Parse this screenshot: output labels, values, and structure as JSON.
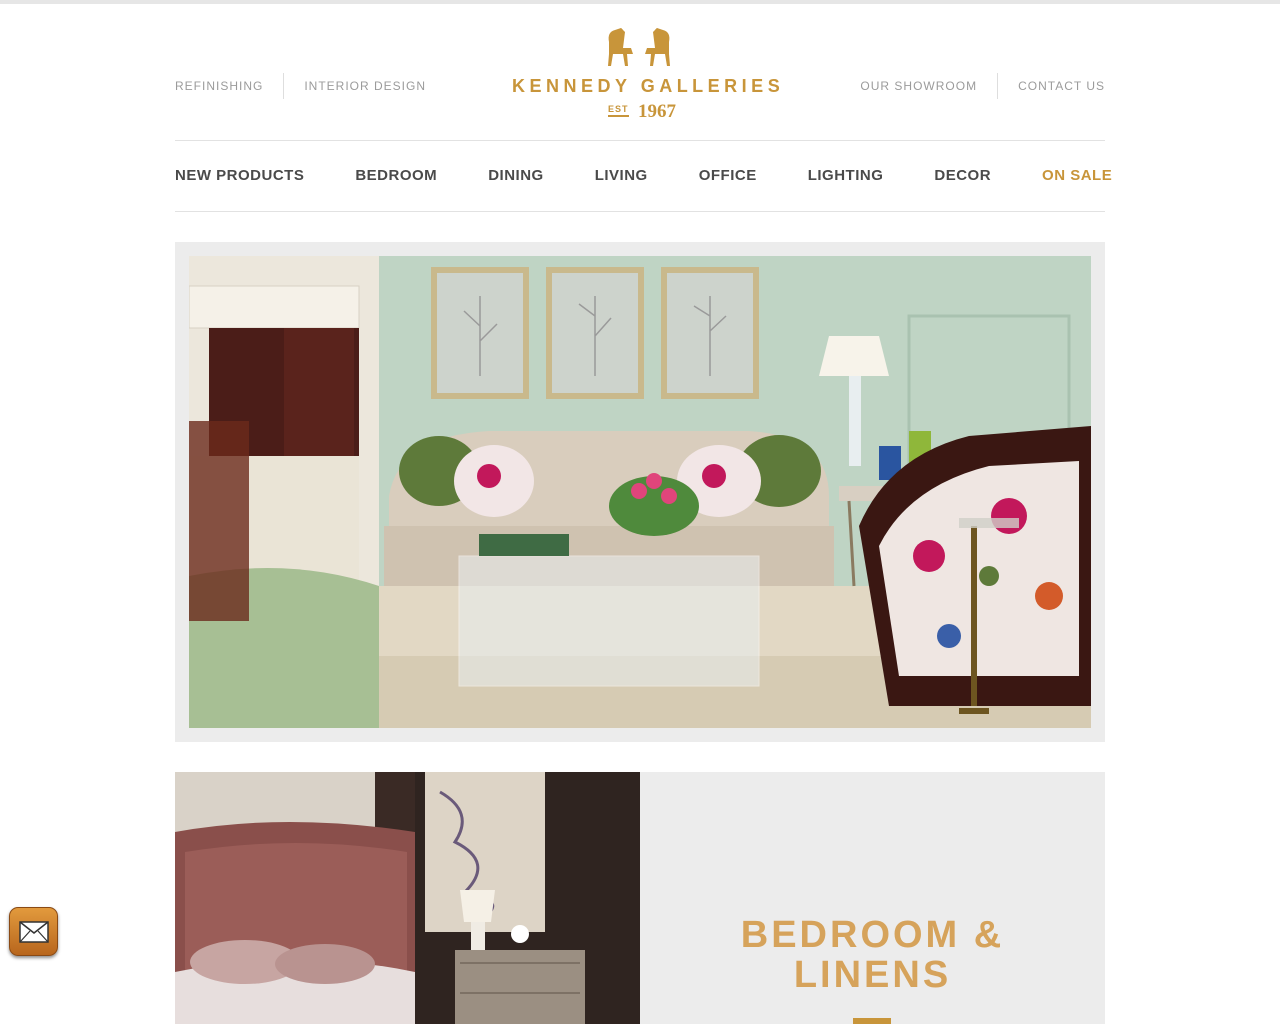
{
  "header": {
    "utility_left": [
      "REFINISHING",
      "INTERIOR DESIGN"
    ],
    "utility_right": [
      "OUR SHOWROOM",
      "CONTACT US"
    ],
    "logo": {
      "brand": "KENNEDY GALLERIES",
      "est": "EST",
      "year": "1967"
    }
  },
  "nav": {
    "items": [
      "NEW PRODUCTS",
      "BEDROOM",
      "DINING",
      "LIVING",
      "OFFICE",
      "LIGHTING",
      "DECOR",
      "ON SALE"
    ]
  },
  "feature": {
    "title_line1": "BEDROOM &",
    "title_line2": "LINENS"
  },
  "colors": {
    "accent": "#c8953a",
    "nav_text": "#4a4a4a",
    "utility_text": "#9b9b9b",
    "panel_bg": "#ececec"
  },
  "icons": {
    "mail": "mail-icon",
    "logo": "chairs-logo-icon"
  }
}
